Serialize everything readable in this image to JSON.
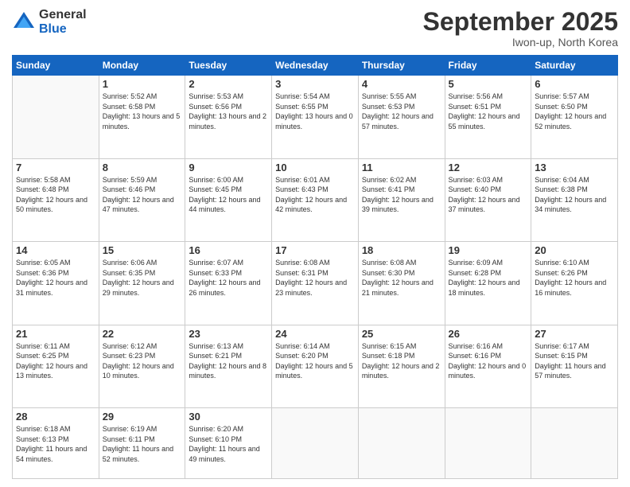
{
  "header": {
    "logo": {
      "line1": "General",
      "line2": "Blue"
    },
    "title": "September 2025",
    "location": "Iwon-up, North Korea"
  },
  "weekdays": [
    "Sunday",
    "Monday",
    "Tuesday",
    "Wednesday",
    "Thursday",
    "Friday",
    "Saturday"
  ],
  "weeks": [
    [
      {
        "day": "",
        "info": ""
      },
      {
        "day": "1",
        "info": "Sunrise: 5:52 AM\nSunset: 6:58 PM\nDaylight: 13 hours\nand 5 minutes."
      },
      {
        "day": "2",
        "info": "Sunrise: 5:53 AM\nSunset: 6:56 PM\nDaylight: 13 hours\nand 2 minutes."
      },
      {
        "day": "3",
        "info": "Sunrise: 5:54 AM\nSunset: 6:55 PM\nDaylight: 13 hours\nand 0 minutes."
      },
      {
        "day": "4",
        "info": "Sunrise: 5:55 AM\nSunset: 6:53 PM\nDaylight: 12 hours\nand 57 minutes."
      },
      {
        "day": "5",
        "info": "Sunrise: 5:56 AM\nSunset: 6:51 PM\nDaylight: 12 hours\nand 55 minutes."
      },
      {
        "day": "6",
        "info": "Sunrise: 5:57 AM\nSunset: 6:50 PM\nDaylight: 12 hours\nand 52 minutes."
      }
    ],
    [
      {
        "day": "7",
        "info": "Sunrise: 5:58 AM\nSunset: 6:48 PM\nDaylight: 12 hours\nand 50 minutes."
      },
      {
        "day": "8",
        "info": "Sunrise: 5:59 AM\nSunset: 6:46 PM\nDaylight: 12 hours\nand 47 minutes."
      },
      {
        "day": "9",
        "info": "Sunrise: 6:00 AM\nSunset: 6:45 PM\nDaylight: 12 hours\nand 44 minutes."
      },
      {
        "day": "10",
        "info": "Sunrise: 6:01 AM\nSunset: 6:43 PM\nDaylight: 12 hours\nand 42 minutes."
      },
      {
        "day": "11",
        "info": "Sunrise: 6:02 AM\nSunset: 6:41 PM\nDaylight: 12 hours\nand 39 minutes."
      },
      {
        "day": "12",
        "info": "Sunrise: 6:03 AM\nSunset: 6:40 PM\nDaylight: 12 hours\nand 37 minutes."
      },
      {
        "day": "13",
        "info": "Sunrise: 6:04 AM\nSunset: 6:38 PM\nDaylight: 12 hours\nand 34 minutes."
      }
    ],
    [
      {
        "day": "14",
        "info": "Sunrise: 6:05 AM\nSunset: 6:36 PM\nDaylight: 12 hours\nand 31 minutes."
      },
      {
        "day": "15",
        "info": "Sunrise: 6:06 AM\nSunset: 6:35 PM\nDaylight: 12 hours\nand 29 minutes."
      },
      {
        "day": "16",
        "info": "Sunrise: 6:07 AM\nSunset: 6:33 PM\nDaylight: 12 hours\nand 26 minutes."
      },
      {
        "day": "17",
        "info": "Sunrise: 6:08 AM\nSunset: 6:31 PM\nDaylight: 12 hours\nand 23 minutes."
      },
      {
        "day": "18",
        "info": "Sunrise: 6:08 AM\nSunset: 6:30 PM\nDaylight: 12 hours\nand 21 minutes."
      },
      {
        "day": "19",
        "info": "Sunrise: 6:09 AM\nSunset: 6:28 PM\nDaylight: 12 hours\nand 18 minutes."
      },
      {
        "day": "20",
        "info": "Sunrise: 6:10 AM\nSunset: 6:26 PM\nDaylight: 12 hours\nand 16 minutes."
      }
    ],
    [
      {
        "day": "21",
        "info": "Sunrise: 6:11 AM\nSunset: 6:25 PM\nDaylight: 12 hours\nand 13 minutes."
      },
      {
        "day": "22",
        "info": "Sunrise: 6:12 AM\nSunset: 6:23 PM\nDaylight: 12 hours\nand 10 minutes."
      },
      {
        "day": "23",
        "info": "Sunrise: 6:13 AM\nSunset: 6:21 PM\nDaylight: 12 hours\nand 8 minutes."
      },
      {
        "day": "24",
        "info": "Sunrise: 6:14 AM\nSunset: 6:20 PM\nDaylight: 12 hours\nand 5 minutes."
      },
      {
        "day": "25",
        "info": "Sunrise: 6:15 AM\nSunset: 6:18 PM\nDaylight: 12 hours\nand 2 minutes."
      },
      {
        "day": "26",
        "info": "Sunrise: 6:16 AM\nSunset: 6:16 PM\nDaylight: 12 hours\nand 0 minutes."
      },
      {
        "day": "27",
        "info": "Sunrise: 6:17 AM\nSunset: 6:15 PM\nDaylight: 11 hours\nand 57 minutes."
      }
    ],
    [
      {
        "day": "28",
        "info": "Sunrise: 6:18 AM\nSunset: 6:13 PM\nDaylight: 11 hours\nand 54 minutes."
      },
      {
        "day": "29",
        "info": "Sunrise: 6:19 AM\nSunset: 6:11 PM\nDaylight: 11 hours\nand 52 minutes."
      },
      {
        "day": "30",
        "info": "Sunrise: 6:20 AM\nSunset: 6:10 PM\nDaylight: 11 hours\nand 49 minutes."
      },
      {
        "day": "",
        "info": ""
      },
      {
        "day": "",
        "info": ""
      },
      {
        "day": "",
        "info": ""
      },
      {
        "day": "",
        "info": ""
      }
    ]
  ]
}
